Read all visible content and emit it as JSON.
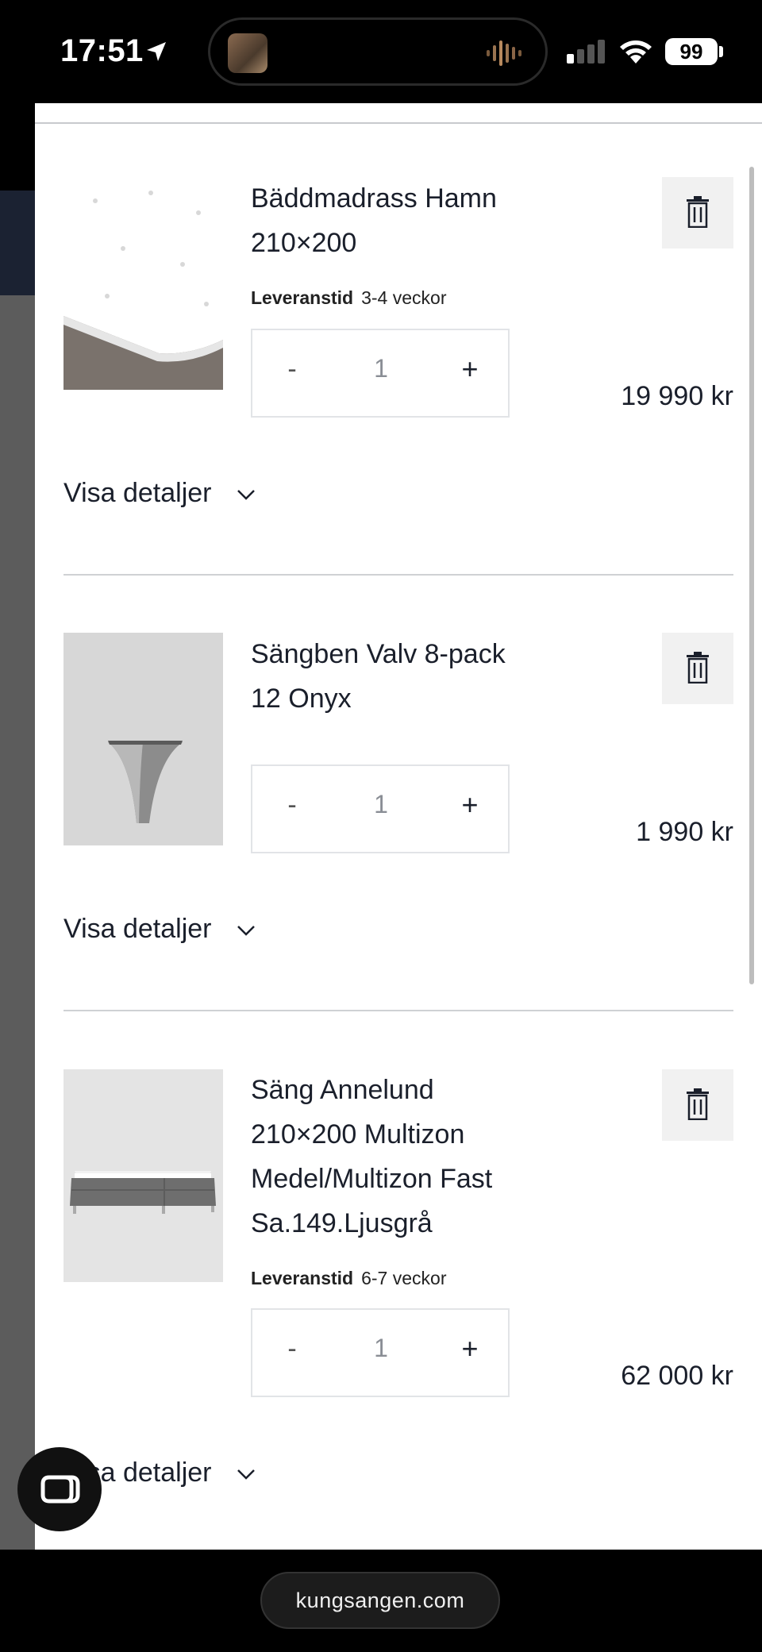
{
  "status_bar": {
    "time": "17:51",
    "battery": "99",
    "icons": [
      "location-arrow-icon",
      "soundwave-icon",
      "cellular-signal-icon",
      "wifi-icon",
      "battery-icon"
    ]
  },
  "cart": {
    "items": [
      {
        "name": "Bäddmadrass Hamn 210×200",
        "delivery_label": "Leveranstid",
        "delivery_value": "3-4 veckor",
        "qty_minus": "-",
        "qty": "1",
        "qty_plus": "+",
        "price": "19 990 kr",
        "details_label": "Visa detaljer"
      },
      {
        "name": "Sängben Valv 8-pack 12 Onyx",
        "qty_minus": "-",
        "qty": "1",
        "qty_plus": "+",
        "price": "1 990 kr",
        "details_label": "Visa detaljer"
      },
      {
        "name": "Säng Annelund 210×200 Multizon Medel/Multizon Fast Sa.149.Ljusgrå",
        "delivery_label": "Leveranstid",
        "delivery_value": "6-7 veckor",
        "qty_minus": "-",
        "qty": "1",
        "qty_plus": "+",
        "price": "62 000 kr",
        "details_label": "Visa detaljer"
      }
    ]
  },
  "browser": {
    "url": "kungsangen.com"
  },
  "colors": {
    "text": "#1a1f2b",
    "trash_bg": "#f1f1f1",
    "divider": "#cfd1d4"
  }
}
